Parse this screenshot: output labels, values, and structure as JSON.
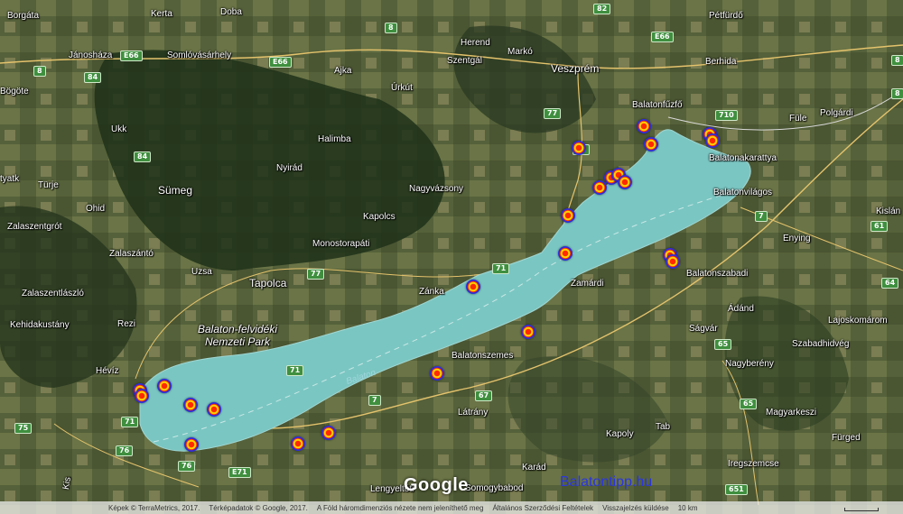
{
  "map": {
    "lake_name": "Balaton",
    "park_name": "Balaton-felvidéki Nemzeti Park",
    "towns": [
      {
        "id": "borgata",
        "name": "Borgáta"
      },
      {
        "id": "kerta",
        "name": "Kerta"
      },
      {
        "id": "doba",
        "name": "Doba"
      },
      {
        "id": "herend",
        "name": "Herend"
      },
      {
        "id": "marko",
        "name": "Markó"
      },
      {
        "id": "veszprem",
        "name": "Veszprém"
      },
      {
        "id": "petfurdo",
        "name": "Pétfürdő"
      },
      {
        "id": "janoshaza",
        "name": "Jánosháza"
      },
      {
        "id": "somlovasarhely",
        "name": "Somlóvásárhely"
      },
      {
        "id": "ajka",
        "name": "Ajka"
      },
      {
        "id": "szentgal",
        "name": "Szentgál"
      },
      {
        "id": "berhida",
        "name": "Berhida"
      },
      {
        "id": "bogote",
        "name": "Bögöte"
      },
      {
        "id": "urkut",
        "name": "Úrkút"
      },
      {
        "id": "balatonfuzfo",
        "name": "Balatonfűzfő"
      },
      {
        "id": "ukk",
        "name": "Ukk"
      },
      {
        "id": "halimba",
        "name": "Halimba"
      },
      {
        "id": "fule",
        "name": "Füle"
      },
      {
        "id": "polgardi",
        "name": "Polgárdi"
      },
      {
        "id": "nyirad",
        "name": "Nyirád"
      },
      {
        "id": "balatonakarattya",
        "name": "Balatonakarattya"
      },
      {
        "id": "tyatk",
        "name": "tyatk"
      },
      {
        "id": "turje",
        "name": "Türje"
      },
      {
        "id": "sumeg",
        "name": "Sümeg"
      },
      {
        "id": "nagyvazsony",
        "name": "Nagyvázsony"
      },
      {
        "id": "balatonvilagos",
        "name": "Balatonvilágos"
      },
      {
        "id": "ohid",
        "name": "Ohid"
      },
      {
        "id": "zalaszentgrot",
        "name": "Zalaszentgrót"
      },
      {
        "id": "kapolcs",
        "name": "Kapolcs"
      },
      {
        "id": "kisla",
        "name": "Kislán"
      },
      {
        "id": "enying",
        "name": "Enying"
      },
      {
        "id": "monostorapati",
        "name": "Monostorapáti"
      },
      {
        "id": "zalaszanto",
        "name": "Zalaszántó"
      },
      {
        "id": "uzsa",
        "name": "Uzsa"
      },
      {
        "id": "zamardi",
        "name": "Zamárdi"
      },
      {
        "id": "balatonszabadi",
        "name": "Balatonszabadi"
      },
      {
        "id": "zalaszentlaszlo",
        "name": "Zalaszentlászló"
      },
      {
        "id": "tapolca",
        "name": "Tapolca"
      },
      {
        "id": "zanka",
        "name": "Zánka"
      },
      {
        "id": "adand",
        "name": "Ádánd"
      },
      {
        "id": "kehidakustany",
        "name": "Kehidakustány"
      },
      {
        "id": "rezi",
        "name": "Rezi"
      },
      {
        "id": "lajoskomarom",
        "name": "Lajoskomárom"
      },
      {
        "id": "sagvar",
        "name": "Ságvár"
      },
      {
        "id": "szabadhidveg",
        "name": "Szabadhidvég"
      },
      {
        "id": "balatonszemes",
        "name": "Balatonszemes"
      },
      {
        "id": "heviz",
        "name": "Hévíz"
      },
      {
        "id": "nagybereny",
        "name": "Nagyberény"
      },
      {
        "id": "magyarkeszi",
        "name": "Magyarkeszi"
      },
      {
        "id": "latrany",
        "name": "Látrány"
      },
      {
        "id": "tab",
        "name": "Tab"
      },
      {
        "id": "kapoly",
        "name": "Kapoly"
      },
      {
        "id": "furged",
        "name": "Fürged"
      },
      {
        "id": "karad",
        "name": "Karád"
      },
      {
        "id": "iregszemcse",
        "name": "Iregszemcse"
      },
      {
        "id": "lengyeltoti",
        "name": "Lengyeltóti"
      },
      {
        "id": "somogybabod",
        "name": "Somogybabod"
      },
      {
        "id": "kis",
        "name": "Kis"
      }
    ],
    "road_shields": [
      "8",
      "82",
      "E66",
      "E66",
      "E66",
      "8",
      "84",
      "84",
      "77",
      "73",
      "710",
      "7",
      "71",
      "77",
      "71",
      "64",
      "61",
      "65",
      "65",
      "7",
      "67",
      "71",
      "75",
      "76",
      "76",
      "E71",
      "651",
      "8",
      "8"
    ],
    "marker_count": 27
  },
  "branding": {
    "google": "Google",
    "watermark": "Balatontipp.hu",
    "watermark_color": "#2a35e0"
  },
  "footer": {
    "imagery": "Képek © TerraMetrics, 2017.",
    "mapdata": "Térképadatok © Google, 2017.",
    "three_d": "A Föld háromdimenziós nézete nem jeleníthető meg",
    "terms": "Általános Szerződési Feltételek",
    "report": "Visszajelzés küldése",
    "scale": "10 km"
  },
  "colors": {
    "lake": "#6fbfbf",
    "marker_ring": "#2d2bd8",
    "marker_fill": "#ff2a00",
    "marker_core": "#ffd400"
  }
}
